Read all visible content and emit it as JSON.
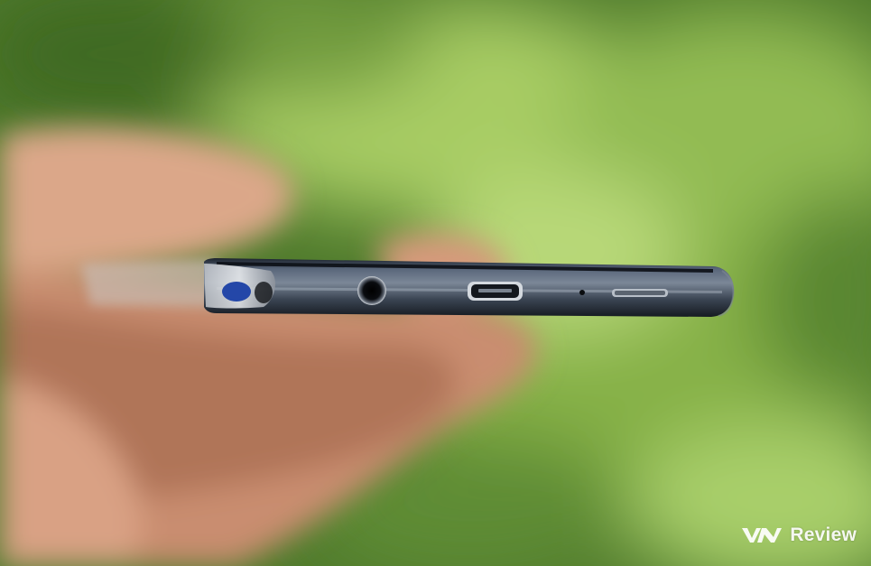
{
  "photo": {
    "subject": "phone-bottom-edge",
    "colors": {
      "background_light": "#9cc25a",
      "background_dark": "#3f6a24",
      "skin": "#d9a184",
      "phone_body": "#2b3440"
    }
  },
  "watermark": {
    "text": "VnReview",
    "suffix": "Review"
  }
}
